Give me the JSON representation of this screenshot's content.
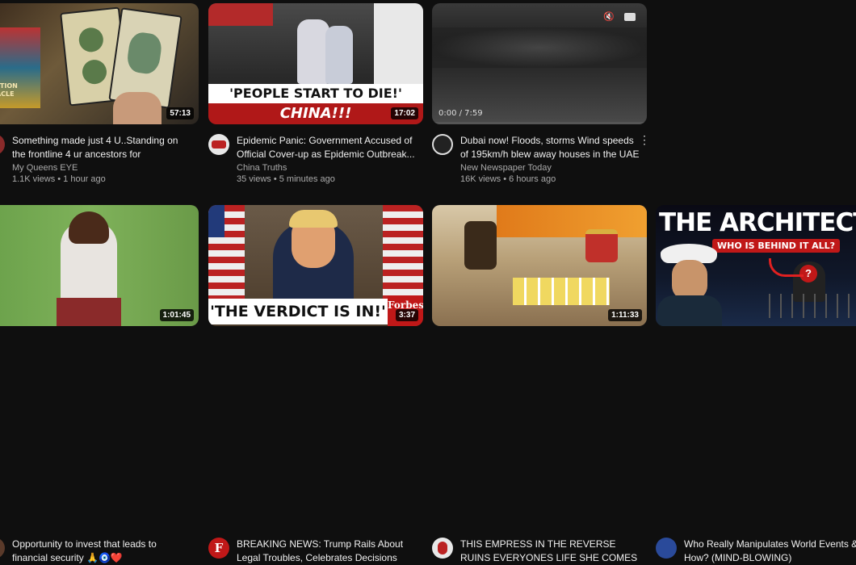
{
  "videos": [
    {
      "title": "Something made just 4 U..Standing on the frontline 4 ur ancestors for generations ...",
      "channel": "My Queens EYE",
      "meta": "1.1K views • 1 hour ago",
      "duration": "57:13",
      "thumb_text": "ITUITION ORACLE"
    },
    {
      "title": "Epidemic Panic: Government Accused of Official Cover-up as Epidemic Outbreak...",
      "channel": "China Truths",
      "meta": "35 views • 5 minutes ago",
      "duration": "17:02",
      "overlay_top": "'PEOPLE START TO DIE!'",
      "overlay_bottom": "CHINA!!!"
    },
    {
      "title": "Dubai now! Floods, storms Wind speeds of 195km/h blew away houses in the UAE",
      "channel": "New Newspaper Today",
      "meta": "16K views • 6 hours ago",
      "progress": "0:00 / 7:59",
      "menu": "⋮"
    },
    {
      "title": "Opportunity to invest that leads to financial security 🙏🧿❤️",
      "duration": "1:01:45"
    },
    {
      "title": "BREAKING NEWS: Trump Rails About Legal Troubles, Celebrates Decisions To...",
      "duration": "3:37",
      "overlay": "'THE VERDICT IS IN!'",
      "badge": "Forbes",
      "avatar_letter": "F"
    },
    {
      "title": "THIS EMPRESS IN THE REVERSE RUINS EVERYONES LIFE SHE COMES IN...",
      "duration": "1:11:33"
    },
    {
      "title": "Who Really Manipulates World Events & How? (MIND-BLOWING)",
      "overlay_top": "THE ARCHITECT",
      "overlay_sub": "WHO IS BEHIND IT ALL?"
    }
  ]
}
